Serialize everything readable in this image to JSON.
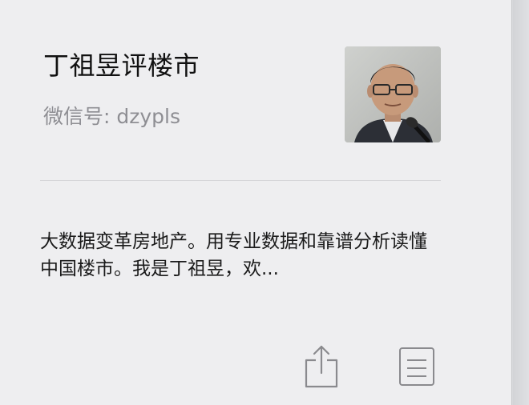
{
  "profile": {
    "name": "丁祖昱评楼市",
    "wechat_id": "微信号: dzypls",
    "avatar_icon": "person-photo",
    "description": "大数据变革房地产。用专业数据和靠谱分析读懂中国楼市。我是丁祖昱，欢..."
  },
  "actions": {
    "share_icon": "share-icon",
    "notes_icon": "document-icon"
  },
  "colors": {
    "panel_bg": "#eeeef0",
    "title_text": "#111111",
    "secondary_text": "#8e8e93",
    "icon_stroke": "#8a8a8e"
  }
}
